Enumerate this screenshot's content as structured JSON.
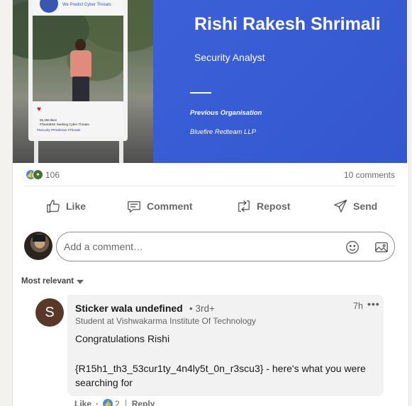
{
  "banner": {
    "name": "Rishi Rakesh Shrimali",
    "role": "Security Analyst",
    "previous_label": "Previous Organisation",
    "previous_org": "Bluefire Redteam LLP",
    "brand_color": "#3a5fd6",
    "photo_frame": {
      "tagline": "We Predict Cyber Threats",
      "likes": "55,456 likes",
      "caption": "#TeamBSK Seeking Cyber Threats",
      "hashtags": "#Security #Predictive #Threats"
    }
  },
  "social": {
    "reaction_count": "106",
    "reaction_icons": [
      "like-icon",
      "celebrate-icon"
    ],
    "comments": "10 comments"
  },
  "actions": [
    {
      "label": "Like",
      "icon": "thumbs-up-icon"
    },
    {
      "label": "Comment",
      "icon": "comment-bubble-icon"
    },
    {
      "label": "Repost",
      "icon": "repost-icon"
    },
    {
      "label": "Send",
      "icon": "paper-plane-icon"
    }
  ],
  "composer": {
    "placeholder": "Add a comment…",
    "icons": [
      "emoji-icon",
      "image-icon"
    ]
  },
  "sort": {
    "label": "Most relevant"
  },
  "comment": {
    "avatar_letter": "S",
    "author": "Sticker wala undefined",
    "degree": "• 3rd+",
    "headline": "Student at Vishwakarma Institute Of Technology",
    "time": "7h",
    "more": "•••",
    "text1": "Congratulations Rishi",
    "text2": "{R15h1_th3_53cur1ty_4n4ly5t_0n_r3scu3} - here's what you were searching for",
    "like_label": "Like",
    "like_count": "2",
    "reply_label": "Reply"
  }
}
